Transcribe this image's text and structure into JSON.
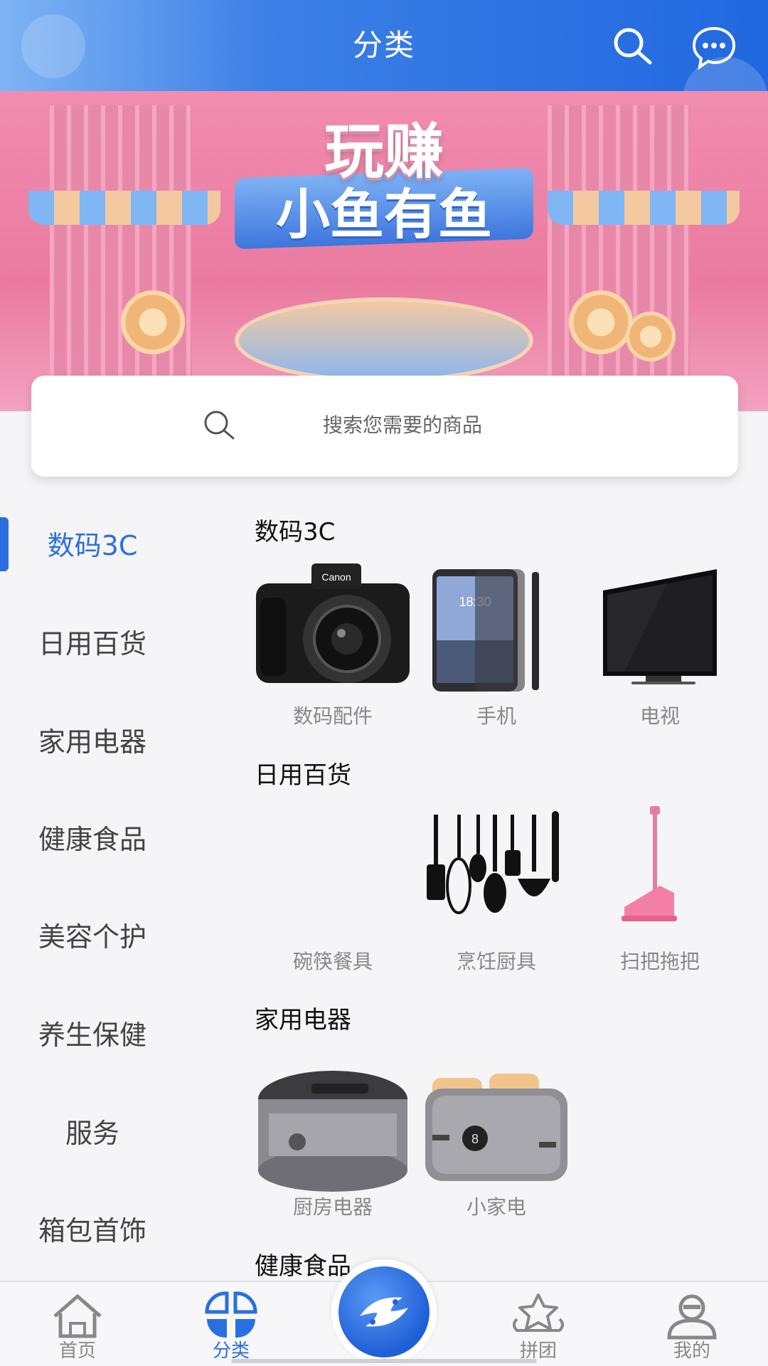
{
  "header": {
    "title": "分类"
  },
  "banner": {
    "line1": "玩赚",
    "line2": "小鱼有鱼"
  },
  "search": {
    "placeholder": "搜索您需要的商品"
  },
  "sidebar": {
    "items": [
      {
        "label": "数码3C",
        "active": true
      },
      {
        "label": "日用百货",
        "active": false
      },
      {
        "label": "家用电器",
        "active": false
      },
      {
        "label": "健康食品",
        "active": false
      },
      {
        "label": "美容个护",
        "active": false
      },
      {
        "label": "养生保健",
        "active": false
      },
      {
        "label": "服务",
        "active": false
      },
      {
        "label": "箱包首饰",
        "active": false
      }
    ]
  },
  "sections": [
    {
      "title": "数码3C",
      "products": [
        {
          "label": "数码配件",
          "icon": "camera-icon"
        },
        {
          "label": "手机",
          "icon": "phone-icon"
        },
        {
          "label": "电视",
          "icon": "tv-icon"
        }
      ]
    },
    {
      "title": "日用百货",
      "products": [
        {
          "label": "碗筷餐具",
          "icon": ""
        },
        {
          "label": "烹饪厨具",
          "icon": "kitchen-tools-icon"
        },
        {
          "label": "扫把拖把",
          "icon": "dustpan-icon"
        }
      ]
    },
    {
      "title": "家用电器",
      "products": [
        {
          "label": "厨房电器",
          "icon": "rice-cooker-icon"
        },
        {
          "label": "小家电",
          "icon": "toaster-icon"
        }
      ]
    },
    {
      "title": "健康食品",
      "products": []
    }
  ],
  "bottom_nav": {
    "items": [
      {
        "label": "首页",
        "icon": "home-icon",
        "active": false
      },
      {
        "label": "分类",
        "icon": "category-icon",
        "active": true
      },
      {
        "label": "拼团",
        "icon": "group-buy-icon",
        "active": false
      },
      {
        "label": "我的",
        "icon": "profile-icon",
        "active": false
      }
    ]
  },
  "colors": {
    "accent": "#2a6fe0",
    "header_start": "#7fb4f4",
    "header_end": "#2168e0"
  }
}
